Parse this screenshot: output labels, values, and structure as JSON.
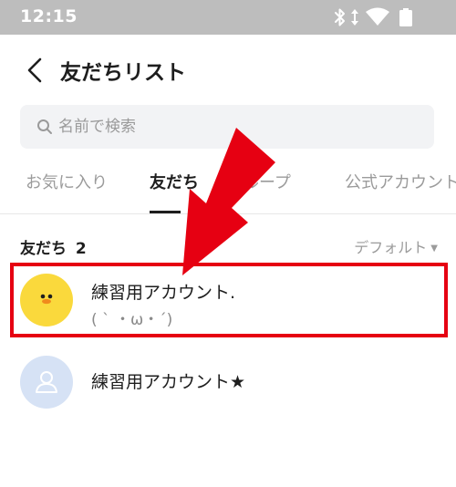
{
  "status_bar": {
    "time": "12:15",
    "icons": [
      "bluetooth-icon",
      "data-arrows-icon",
      "wifi-icon",
      "battery-icon"
    ]
  },
  "header": {
    "back_icon": "chevron-left-icon",
    "title": "友だちリスト"
  },
  "search": {
    "icon": "search-icon",
    "placeholder": "名前で検索",
    "value": ""
  },
  "tabs": [
    {
      "label": "お気に入り",
      "active": false
    },
    {
      "label": "友だち",
      "active": true
    },
    {
      "label": "グループ",
      "active": false
    },
    {
      "label": "公式アカウント",
      "active": false
    }
  ],
  "section": {
    "label": "友だち",
    "count": "2",
    "sort_label": "デフォルト",
    "sort_icon": "caret-down-icon"
  },
  "friends": [
    {
      "name": "練習用アカウント.",
      "status": "( ` ・ω・´)",
      "avatar": "duck-avatar"
    },
    {
      "name": "練習用アカウント★",
      "status": "",
      "avatar": "default-person-avatar"
    }
  ],
  "overlay": {
    "arrow_color": "#e60012",
    "highlight_color": "#e60012"
  },
  "colors": {
    "status_bar_bg": "#bdbdbd",
    "search_bg": "#f2f3f5",
    "text_primary": "#1e1e1e",
    "text_secondary": "#9b9b9b",
    "avatar_yellow": "#fad93c",
    "avatar_blue": "#d6e2f5"
  }
}
